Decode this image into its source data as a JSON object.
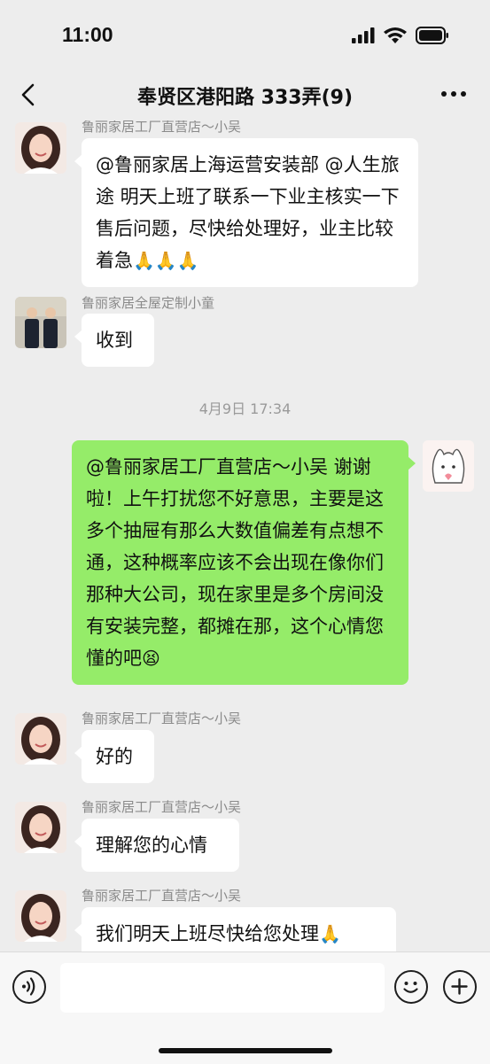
{
  "status": {
    "time": "11:00"
  },
  "nav": {
    "title": "奉贤区港阳路 333弄(9)"
  },
  "messages": [
    {
      "sender": "鲁丽家居工厂直营店～小吴",
      "text": "@鲁丽家居上海运营安装部 @人生旅途 明天上班了联系一下业主核实一下售后问题，尽快给处理好，业主比较着急",
      "emoji": "🙏🙏🙏"
    },
    {
      "sender": "鲁丽家居全屋定制小童",
      "text": "收到"
    },
    {
      "timestamp": "4月9日 17:34"
    },
    {
      "sender": "",
      "text": "@鲁丽家居工厂直营店～小吴 谢谢啦！上午打扰您不好意思，主要是这多个抽屉有那么大数值偏差有点想不通，这种概率应该不会出现在像你们那种大公司，现在家里是多个房间没有安装完整，都摊在那，这个心情您懂的吧",
      "emoji": "😫"
    },
    {
      "sender": "鲁丽家居工厂直营店～小吴",
      "text": "好的"
    },
    {
      "sender": "鲁丽家居工厂直营店～小吴",
      "text": "理解您的心情"
    },
    {
      "sender": "鲁丽家居工厂直营店～小吴",
      "text": "我们明天上班尽快给您处理",
      "emoji": "🙏"
    }
  ],
  "input": {
    "value": ""
  },
  "colors": {
    "background": "#ededed",
    "outgoing_bubble": "#95ec69",
    "incoming_bubble": "#ffffff"
  }
}
